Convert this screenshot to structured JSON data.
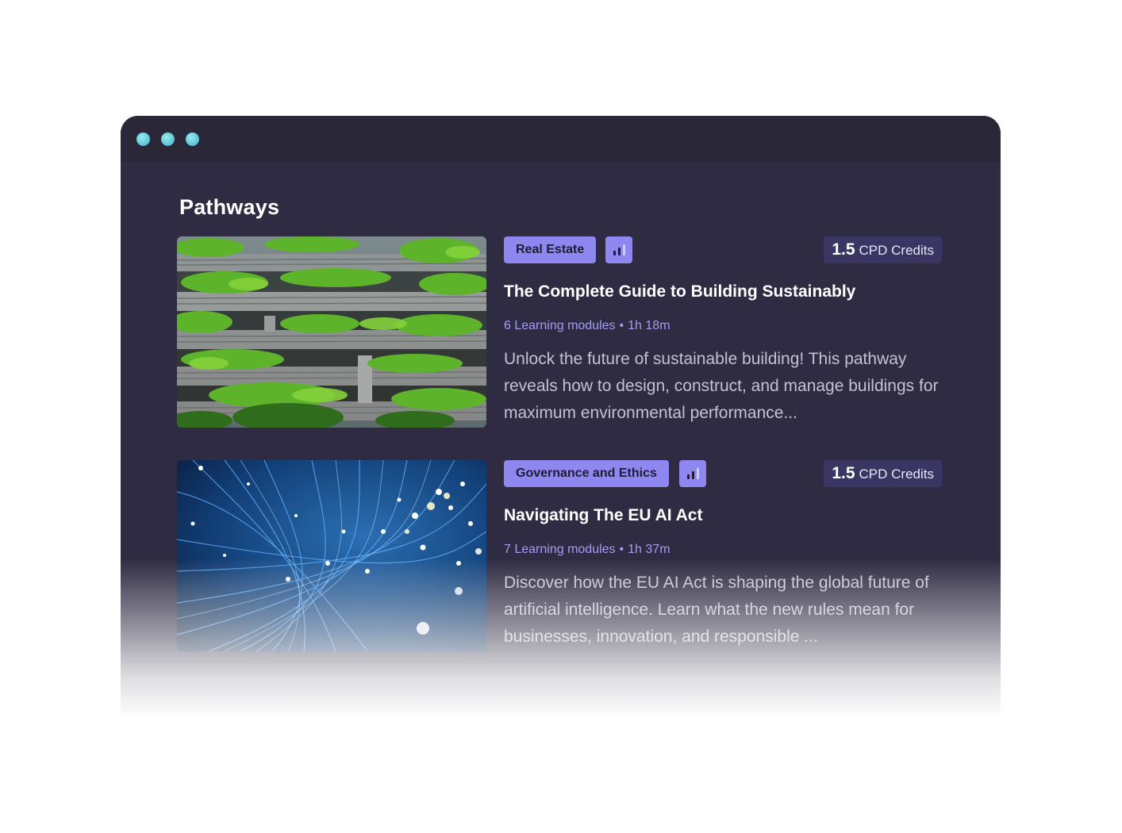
{
  "window": {
    "controls": [
      "window-dot-1",
      "window-dot-2",
      "window-dot-3"
    ]
  },
  "page": {
    "title": "Pathways"
  },
  "pathways": [
    {
      "tag": "Real Estate",
      "level_icon": "bar-chart-icon",
      "credits_value": "1.5",
      "credits_label": "CPD Credits",
      "title": "The Complete Guide to Building Sustainably",
      "modules": "6 Learning modules",
      "separator": "•",
      "duration": "1h 18m",
      "description": "Unlock the future of sustainable building! This pathway reveals how to design, construct, and manage buildings for maximum environmental performance...",
      "image": "green-building-image"
    },
    {
      "tag": "Governance and Ethics",
      "level_icon": "bar-chart-icon",
      "credits_value": "1.5",
      "credits_label": "CPD Credits",
      "title": "Navigating The EU AI Act",
      "modules": "7 Learning modules",
      "separator": "•",
      "duration": "1h 37m",
      "description": "Discover how the EU AI Act is shaping the global future of artificial intelligence. Learn what the new rules mean for businesses, innovation, and responsible ...",
      "image": "fiber-optic-image"
    }
  ],
  "colors": {
    "window_bg": "#2e2b42",
    "titlebar_bg": "#2a2738",
    "tag_bg": "#8f87f0",
    "credits_bg": "#3a3663",
    "meta_text": "#a59cf3",
    "dot": "#58c3d4"
  }
}
